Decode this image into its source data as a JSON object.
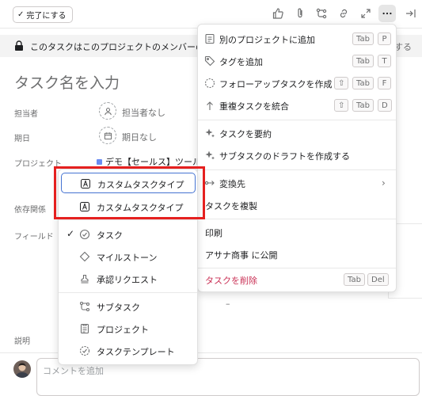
{
  "toolbar": {
    "complete_label": "完了にする",
    "icons": [
      "thumbs-up-icon",
      "paperclip-icon",
      "subtask-icon",
      "link-icon",
      "expand-icon",
      "more-icon",
      "close-panel-icon"
    ]
  },
  "banner": {
    "text": "このタスクはこのプロジェクトのメンバーの",
    "action": "する"
  },
  "task": {
    "name_placeholder": "タスク名を入力",
    "assignee_label": "担当者",
    "assignee_value": "担当者なし",
    "due_label": "期日",
    "due_value": "期日なし",
    "project_label": "プロジェクト",
    "project_value": "デモ【セールス】ツール",
    "dependency_label": "依存関係",
    "fields_label": "フィールド",
    "description_label": "説明",
    "dash": "–"
  },
  "comment": {
    "placeholder": "コメントを追加"
  },
  "menu": {
    "items": [
      {
        "label": "別のプロジェクトに追加",
        "icon": "add-to-project-icon",
        "keys": [
          "Tab",
          "P"
        ]
      },
      {
        "label": "タグを追加",
        "icon": "tag-icon",
        "keys": [
          "Tab",
          "T"
        ]
      },
      {
        "label": "フォローアップタスクを作成",
        "icon": "follow-up-icon",
        "keys": [
          "⇧",
          "Tab",
          "F"
        ]
      },
      {
        "label": "重複タスクを統合",
        "icon": "merge-icon",
        "keys": [
          "⇧",
          "Tab",
          "D"
        ]
      },
      {
        "label": "タスクを要約",
        "icon": "sparkle-icon"
      },
      {
        "label": "サブタスクのドラフトを作成する",
        "icon": "sparkle-icon"
      },
      {
        "label": "変換先",
        "icon": "convert-icon"
      },
      {
        "label": "タスクを複製"
      },
      {
        "label": "印刷"
      },
      {
        "label": "アサナ商事 に公開"
      },
      {
        "label": "タスクを削除",
        "keys": [
          "Tab",
          "Del"
        ]
      }
    ]
  },
  "submenu": {
    "items": [
      {
        "label": "カスタムタスクタイプ",
        "icon": "custom-type-icon",
        "selected": true
      },
      {
        "label": "カスタムタスクタイプ",
        "icon": "custom-type-icon"
      },
      {
        "label": "タスク",
        "icon": "check-circle-icon",
        "checked": "✓"
      },
      {
        "label": "マイルストーン",
        "icon": "milestone-icon"
      },
      {
        "label": "承認リクエスト",
        "icon": "approval-icon"
      },
      {
        "label": "サブタスク",
        "icon": "subtask-icon"
      },
      {
        "label": "プロジェクト",
        "icon": "project-icon"
      },
      {
        "label": "タスクテンプレート",
        "icon": "template-icon"
      }
    ]
  }
}
